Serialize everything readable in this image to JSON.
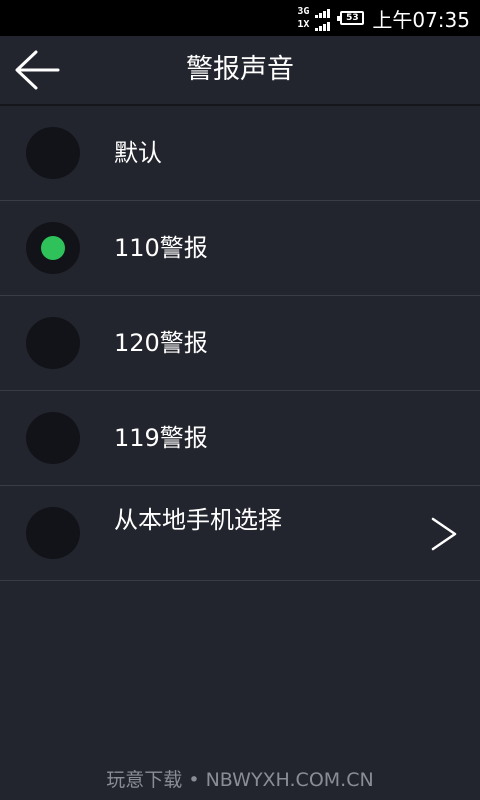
{
  "status_bar": {
    "network_top": "3G",
    "network_bottom": "1X",
    "battery": "53",
    "time": "上午07:35"
  },
  "header": {
    "title": "警报声音",
    "back_icon": "arrow-left-icon"
  },
  "options": [
    {
      "label": "默认",
      "selected": false
    },
    {
      "label": "110警报",
      "selected": true
    },
    {
      "label": "120警报",
      "selected": false
    },
    {
      "label": "119警报",
      "selected": false
    },
    {
      "label": "从本地手机选择",
      "selected": false,
      "has_chevron": true
    }
  ],
  "watermark": "玩意下载 • NBWYXH.COM.CN",
  "colors": {
    "background": "#23252e",
    "status_bar": "#000000",
    "radio_bg": "#121319",
    "selected_dot": "#2fc25a",
    "divider": "#3a3d48"
  }
}
